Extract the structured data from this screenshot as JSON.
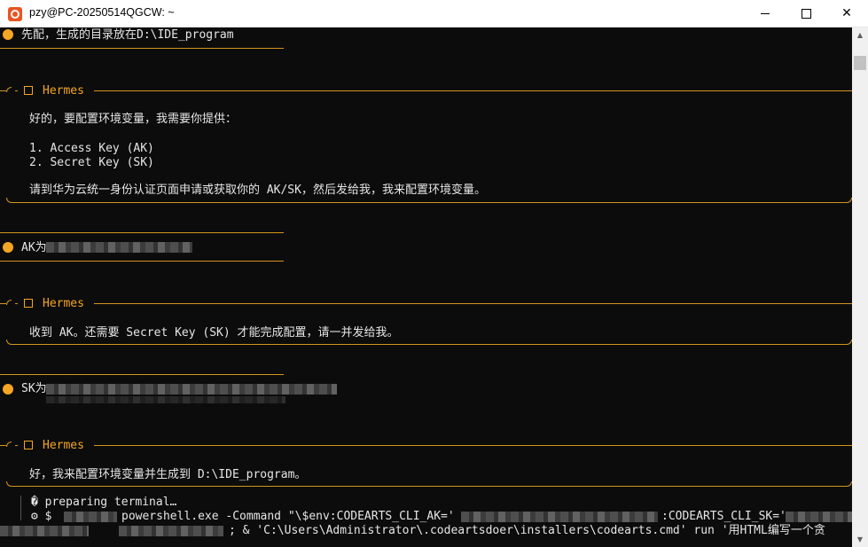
{
  "window": {
    "title": "pzy@PC-20250514QGCW: ~",
    "icon": "ubuntu-icon",
    "buttons": {
      "minimize": "minimize-icon",
      "maximize": "maximize-icon",
      "close": "✕"
    }
  },
  "conversation": {
    "user_1": "先配，生成的目录放在D:\\IDE_program",
    "assistant_name": "Hermes",
    "assistant_1": {
      "intro": "好的，要配置环境变量，我需要你提供：",
      "item_1": "1. Access Key (AK)",
      "item_2": "2. Secret Key (SK)",
      "outro": "请到华为云统一身份认证页面申请或获取你的 AK/SK，然后发给我，我来配置环境变量。"
    },
    "user_2_prefix": "AK为",
    "assistant_2": "收到 AK。还需要 Secret Key (SK) 才能完成配置，请一并发给我。",
    "user_3_prefix": "SK为",
    "assistant_3": "好，我来配置环境变量并生成到 D:\\IDE_program。",
    "tool": {
      "status": "� preparing terminal…",
      "cmd_prefix": "⚙ $",
      "cmd_1": "powershell.exe -Command \"\\$env:CODEARTS_CLI_AK='",
      "cmd_1b": ":CODEARTS_CLI_SK='",
      "cmd_2": "; & 'C:\\Users\\Administrator\\.codeartsdoer\\installers\\codearts.cmd' run '用HTML编写一个贪"
    }
  },
  "colors": {
    "accent": "#f5a623",
    "background": "#0c0c0c",
    "text": "#e6e6e6"
  }
}
